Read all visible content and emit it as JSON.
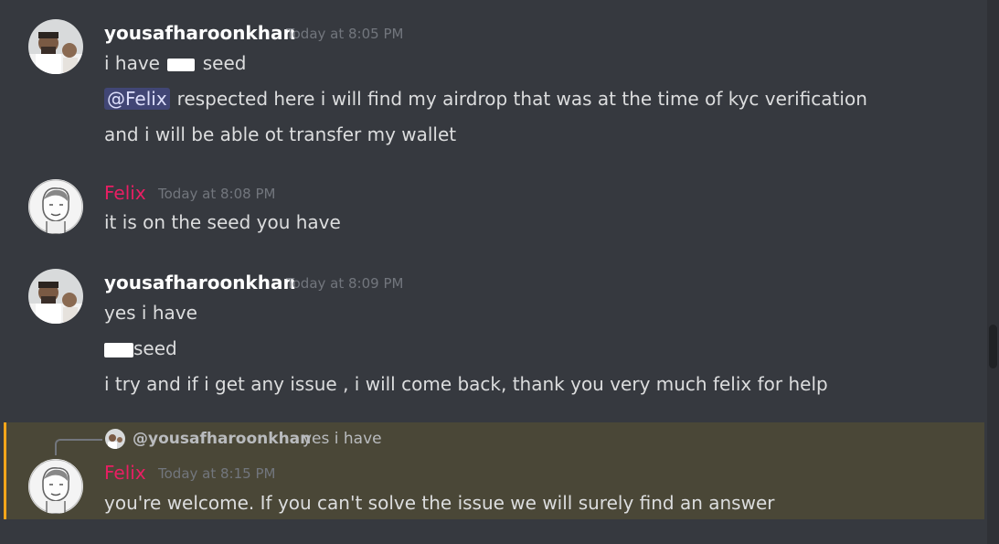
{
  "messages": [
    {
      "author": "yousafharoonkhan",
      "timestamp": "Today at 8:05 PM",
      "line1_pre": "i have",
      "line1_post": "seed",
      "mention": "@Felix",
      "line2": "respected here i will find my airdrop that was at the time of kyc verification",
      "line3": "and i will be able ot transfer my wallet"
    },
    {
      "author": "Felix",
      "timestamp": "Today at 8:08 PM",
      "line1": "it is on the seed you have"
    },
    {
      "author": "yousafharoonkhan",
      "timestamp": "Today at 8:09 PM",
      "line1": "yes i have",
      "line2_post": "seed",
      "line3": "i try and if i get any issue , i will come back, thank you very much felix for help"
    },
    {
      "reply_to": "@yousafharoonkhan",
      "reply_text": "yes i have",
      "author": "Felix",
      "timestamp": "Today at 8:15 PM",
      "line1": "you're welcome. If you can't solve the issue we will surely find an answer"
    }
  ],
  "colors": {
    "background": "#36393f",
    "felix_name": "#e91e63",
    "mention_bg": "#414675",
    "highlight_bg": "#4a4737",
    "highlight_bar": "#faa61a"
  }
}
